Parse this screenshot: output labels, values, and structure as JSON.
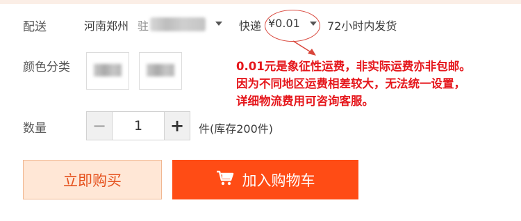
{
  "colors": {
    "accent": "#ff4c15",
    "annotation": "#e5161b",
    "buy_bg": "#ffe7d6"
  },
  "delivery": {
    "label": "配送",
    "location": "河南郑州",
    "location_partial": "驻",
    "method": "快递",
    "price": "¥0.01",
    "ship_time": "72小时内发货"
  },
  "annotation": {
    "lines": [
      "0.01元是象征性运费，非实际运费亦非包邮。",
      "因为不同地区运费相差较大，无法统一设置，",
      "详细物流费用可咨询客服。"
    ]
  },
  "color_category": {
    "label": "颜色分类"
  },
  "quantity": {
    "label": "数量",
    "minus": "−",
    "value": "1",
    "plus": "+",
    "stock": "件(库存200件)"
  },
  "buttons": {
    "buy_now": "立即购买",
    "add_to_cart": "加入购物车",
    "cart_icon": "shopping-cart-icon"
  }
}
